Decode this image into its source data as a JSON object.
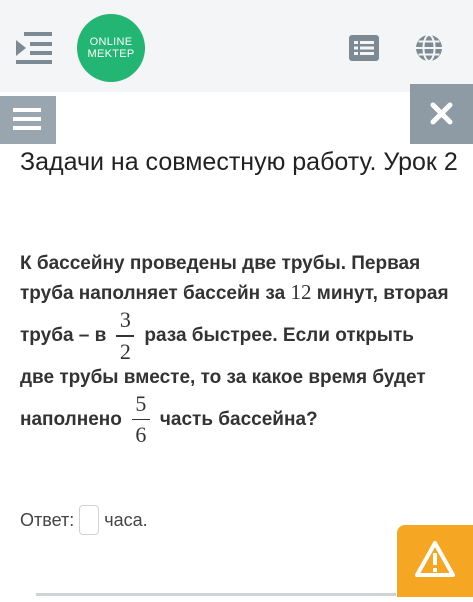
{
  "header": {
    "logo_line1": "ONLINE",
    "logo_line2": "MEKTEP",
    "icons": [
      "menu-toggle-icon",
      "list-icon",
      "globe-icon"
    ]
  },
  "lesson": {
    "title": "Задачи на совместную работу. Урок 2"
  },
  "problem": {
    "text1": "К бассейну проведены две трубы. Первая труба наполняет бассейн за",
    "number1": "12",
    "text2": "минут, вторая труба – в",
    "frac1_num": "3",
    "frac1_den": "2",
    "text3": "раза быстрее. Если открыть две трубы вместе, то за какое время будет наполнено",
    "frac2_num": "5",
    "frac2_den": "6",
    "text4": "часть бассейна?"
  },
  "answer": {
    "label": "Ответ:",
    "input_value": "",
    "unit": "часа."
  },
  "colors": {
    "brand_green": "#22b573",
    "close_button": "#8f9ba4",
    "side_menu_button": "#9aa6af",
    "warning_orange": "#f5a623"
  }
}
